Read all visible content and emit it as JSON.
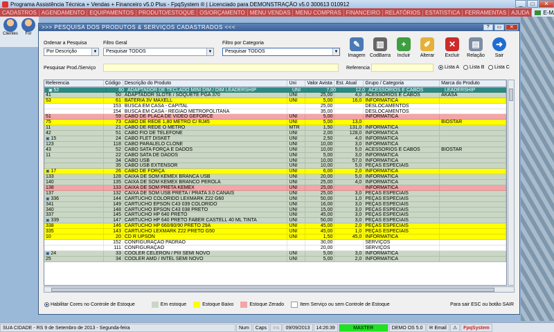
{
  "app": {
    "title": "Programa Assistência Técnica + Vendas + Financeiro v5.0 Plus - FpqSystem ® | Licenciado para  DEMONSTRAÇÃO v5.0 300613 010912"
  },
  "menu": [
    "CADASTROS",
    "AGENDAMENTO",
    "EQUIPAMENTOS",
    "PRODUTO/ESTOQUE",
    "OS/ORÇAMENTO",
    "MENU VENDAS",
    "MENU COMPRAS",
    "FINANCEIRO",
    "RELATÓRIOS",
    "ESTATISTICA",
    "FERRAMENTAS",
    "AJUDA"
  ],
  "menu_email": "E-MAIL",
  "toolbar": {
    "clientes": "Clientes",
    "forn": "For"
  },
  "window": {
    "title": ">>> PESQUISA DOS PRODUTOS & SERVIÇOS CADASTRADOS <<<"
  },
  "filters": {
    "ordenar_label": "Ordenar a Pesquisa",
    "ordenar_value": "Por Descrição",
    "filtro_geral_label": "Filtro Geral",
    "filtro_geral_value": "Pesquisar TODOS",
    "filtro_cat_label": "Filtro por Categoria",
    "filtro_cat_value": "Pesquisar TODOS",
    "pesquisa_label": "Pesquisar Prod./Serviço",
    "referencia_label": "Referencia"
  },
  "buttons": {
    "imagem": "Imagem",
    "codbarra": "CodBarra",
    "incluir": "Incluir",
    "alterar": "Alterar",
    "excluir": "Excluir",
    "relacao": "Relação",
    "sair": "Sair"
  },
  "lists": {
    "a": "Lista A",
    "b": "Lista B",
    "c": "Lista C"
  },
  "grid": {
    "headers": [
      "Referencia",
      "Código",
      "Descrição do Produto",
      "Uni",
      "Valor Avista",
      "Est. Atual",
      "Grupo / Categoria",
      "Marca do Produto"
    ],
    "rows": [
      {
        "c": "sel",
        "m": "1",
        "ref": "52",
        "cod": "60",
        "desc": "ADAPTADOR DE TECLADO MINI DIM / DIM LEADERSHIP",
        "uni": "UNI",
        "val": "7,00",
        "est": "12,0",
        "grp": "ACESSÓRIOS E CABOS",
        "marca": "LEADERSHIP"
      },
      {
        "c": "green",
        "m": "",
        "ref": "47",
        "cod": "56",
        "desc": "ADAPTADOR DE TECLADO DIM / MINI",
        "uni": "UNI",
        "val": "7,00",
        "est": "5,0",
        "grp": "ACESSÓRIOS E CABOS",
        "marca": "AIRLINK"
      },
      {
        "c": "green",
        "m": "",
        "ref": "41",
        "cod": "50",
        "desc": "ADAPTADOR SLOTE / SOQUETE PGA 370",
        "uni": "UNI",
        "val": "25,00",
        "est": "4,0",
        "grp": "ACESSÓRIOS E CABOS",
        "marca": "AKASA"
      },
      {
        "c": "yellow",
        "m": "",
        "ref": "53",
        "cod": "61",
        "desc": "BATERIA 3V MAXELL",
        "uni": "UNI",
        "val": "5,00",
        "est": "16,0",
        "grp": "INFORMATICA",
        "marca": ""
      },
      {
        "c": "white",
        "m": "",
        "ref": "",
        "cod": "153",
        "desc": "BUSCA EM CASA - CAPITAL",
        "uni": "",
        "val": "25,00",
        "est": "",
        "grp": "DESLOCAMENTOS",
        "marca": ""
      },
      {
        "c": "white",
        "m": "",
        "ref": "",
        "cod": "154",
        "desc": "BUSCA EM CASA - REGIAO METROPOLITANA",
        "uni": "",
        "val": "35,00",
        "est": "",
        "grp": "DESLOCAMENTOS",
        "marca": ""
      },
      {
        "c": "pink",
        "m": "",
        "ref": "51",
        "cod": "59",
        "desc": "CABO DE PLACA DE VIDEO GEFORCE",
        "uni": "UNI",
        "val": "5,00",
        "est": "",
        "grp": "INFORMATICA",
        "marca": ""
      },
      {
        "c": "yellow",
        "m": "",
        "ref": "75",
        "cod": "73",
        "desc": "CABO DE REDE 1,80 METRO C/ RJ45",
        "uni": "UNI",
        "val": "5,00",
        "est": "13,0",
        "grp": "",
        "marca": "BIOSTAR"
      },
      {
        "c": "green",
        "m": "",
        "ref": "11",
        "cod": "21",
        "desc": "CABO DE REDE O METRO",
        "uni": "MTR",
        "val": "1,50",
        "est": "131,0",
        "grp": "INFORMATICA",
        "marca": ""
      },
      {
        "c": "green",
        "m": "",
        "ref": "42",
        "cod": "51",
        "desc": "CABO FIO DE TELEFONE",
        "uni": "UNI",
        "val": "2,00",
        "est": "128,0",
        "grp": "INFORMATICA",
        "marca": ""
      },
      {
        "c": "green",
        "m": "1",
        "ref": "15",
        "cod": "24",
        "desc": "CABO FLET DISKET",
        "uni": "UNI",
        "val": "2,50",
        "est": "4,0",
        "grp": "INFORMATICA",
        "marca": ""
      },
      {
        "c": "green",
        "m": "",
        "ref": "123",
        "cod": "118",
        "desc": "CABO PARALELO CLONE",
        "uni": "UNI",
        "val": "10,00",
        "est": "3,0",
        "grp": "INFORMATICA",
        "marca": ""
      },
      {
        "c": "green",
        "m": "",
        "ref": "43",
        "cod": "52",
        "desc": "CABO SATA FORÇA E DADOS",
        "uni": "UNI",
        "val": "10,00",
        "est": "5,0",
        "grp": "ACESSÓRIOS E CABOS",
        "marca": "BIOSTAR"
      },
      {
        "c": "green",
        "m": "",
        "ref": "11",
        "cod": "22",
        "desc": "CABO SATA DE DADOS",
        "uni": "UNI",
        "val": "5,00",
        "est": "3,0",
        "grp": "INFORMATICA",
        "marca": ""
      },
      {
        "c": "green",
        "m": "",
        "ref": "",
        "cod": "34",
        "desc": "CABO USB",
        "uni": "UNI",
        "val": "10,00",
        "est": "57,0",
        "grp": "INFORMATICA",
        "marca": ""
      },
      {
        "c": "green",
        "m": "",
        "ref": "",
        "cod": "35",
        "desc": "CABO USB EXTENSOR",
        "uni": "UNI",
        "val": "10,00",
        "est": "5,0",
        "grp": "PEÇAS ESPECIAIS",
        "marca": ""
      },
      {
        "c": "yellow",
        "m": "1",
        "ref": "17",
        "cod": "26",
        "desc": "CABO DE FORÇA",
        "uni": "UNI",
        "val": "6,00",
        "est": "2,0",
        "grp": "INFORMATICA",
        "marca": ""
      },
      {
        "c": "green",
        "m": "",
        "ref": "133",
        "cod": "128",
        "desc": "CAIXA DE SOM KEMEX BRANCA USB",
        "uni": "UNI",
        "val": "20,00",
        "est": "5,0",
        "grp": "INFORMATICA",
        "marca": ""
      },
      {
        "c": "green",
        "m": "",
        "ref": "140",
        "cod": "135",
        "desc": "CAIXA DE SOM KEMEX BRANCO PÉROLA",
        "uni": "UNI",
        "val": "25,00",
        "est": "4,0",
        "grp": "INFORMATICA",
        "marca": ""
      },
      {
        "c": "pink",
        "m": "",
        "ref": "138",
        "cod": "133",
        "desc": "CAIXA DE SOM PRETA KEMEX",
        "uni": "UNI",
        "val": "25,00",
        "est": "",
        "grp": "INFORMATICA",
        "marca": ""
      },
      {
        "c": "green",
        "m": "",
        "ref": "137",
        "cod": "132",
        "desc": "CAIXA DE SOM USB PRETA / PRATA 3.0 CANAIS",
        "uni": "UNI",
        "val": "25,00",
        "est": "3,0",
        "grp": "PEÇAS ESPECIAIS",
        "marca": ""
      },
      {
        "c": "green",
        "m": "1",
        "ref": "336",
        "cod": "144",
        "desc": "CARTUCHO COLORIDO LEXMARK Z22 G60",
        "uni": "UNI",
        "val": "50,00",
        "est": "1,0",
        "grp": "PEÇAS ESPECIAIS",
        "marca": ""
      },
      {
        "c": "green",
        "m": "",
        "ref": "341",
        "cod": "149",
        "desc": "CARTUCHO EPSON C43 039 COLORIDO",
        "uni": "UNI",
        "val": "16,00",
        "est": "3,0",
        "grp": "PEÇAS ESPECIAIS",
        "marca": ""
      },
      {
        "c": "green",
        "m": "",
        "ref": "340",
        "cod": "148",
        "desc": "CARTUCHO EPSON C43 038 PRETO",
        "uni": "UNI",
        "val": "15,00",
        "est": "3,0",
        "grp": "PEÇAS ESPECIAIS",
        "marca": ""
      },
      {
        "c": "green",
        "m": "",
        "ref": "337",
        "cod": "145",
        "desc": "CARTUCHO HP 640 PRETO",
        "uni": "UNI",
        "val": "45,00",
        "est": "3,0",
        "grp": "PEÇAS ESPECIAIS",
        "marca": ""
      },
      {
        "c": "green",
        "m": "1",
        "ref": "339",
        "cod": "147",
        "desc": "CARTUCHO HP 640 PRETO FABER CASTELL 40 ML TINTA",
        "uni": "UNI",
        "val": "50,00",
        "est": "3,0",
        "grp": "PEÇAS ESPECIAIS",
        "marca": ""
      },
      {
        "c": "yellow",
        "m": "",
        "ref": "338",
        "cod": "146",
        "desc": "CARTUCHO HP 660/80/90 PRETO 29A",
        "uni": "UNI",
        "val": "45,00",
        "est": "2,0",
        "grp": "PEÇAS ESPECIAIS",
        "marca": ""
      },
      {
        "c": "yellow",
        "m": "",
        "ref": "335",
        "cod": "143",
        "desc": "CARTUCHO LEXMARK Z22 PRETO G50",
        "uni": "UNI",
        "val": "45,00",
        "est": "1,0",
        "grp": "PEÇAS ESPECIAIS",
        "marca": ""
      },
      {
        "c": "yellow",
        "m": "",
        "ref": "10",
        "cod": "20",
        "desc": "CD R UPSON",
        "uni": "UNI",
        "val": "1,50",
        "est": "45,0",
        "grp": "INFORMATICA",
        "marca": ""
      },
      {
        "c": "white",
        "m": "",
        "ref": "",
        "cod": "152",
        "desc": "CONFIGURAÇAO PADRAO",
        "uni": "",
        "val": "30,00",
        "est": "",
        "grp": "SERVIÇOS",
        "marca": ""
      },
      {
        "c": "white",
        "m": "",
        "ref": "",
        "cod": "111",
        "desc": "CONFIGURAÇÃO",
        "uni": "",
        "val": "20,00",
        "est": "",
        "grp": "SERVIÇOS",
        "marca": ""
      },
      {
        "c": "green",
        "m": "1",
        "ref": "24",
        "cod": "33",
        "desc": "COOLER CELERON / PIII SEMI NOVO",
        "uni": "UNI",
        "val": "5,00",
        "est": "3,0",
        "grp": "INFORMATICA",
        "marca": ""
      },
      {
        "c": "green",
        "m": "",
        "ref": "25",
        "cod": "34",
        "desc": "COOLER AMD / INTEL SEMI NOVO",
        "uni": "UNI",
        "val": "5,00",
        "est": "2,0",
        "grp": "INFORMATICA",
        "marca": ""
      }
    ]
  },
  "legend": {
    "habilitar": "Habilitar Cores no Controle de Estoque",
    "em_estoque": "Em estoque",
    "estoque_baixo": "Estoque Baixo",
    "estoque_zerado": "Estoque Zerado",
    "item_servico": "Item Serviço ou sem Controle de Estoque",
    "sair_hint": "Para sair ESC ou botão SAIR",
    "color_green": "#c9d7c4",
    "color_yellow": "#ffff00",
    "color_pink": "#f4a5a5",
    "color_white": "#ffffff"
  },
  "status": {
    "city": "SUA CIDADE - RS 9 de Setembro de 2013 - Segunda-feira",
    "num": "Num",
    "caps": "Caps",
    "ins": "Ins",
    "date": "09/09/2013",
    "time": "14:26:39",
    "master": "MASTER",
    "demo": "DEMO OS 5.0",
    "email": "Email",
    "fpq": "FpqSystem"
  }
}
